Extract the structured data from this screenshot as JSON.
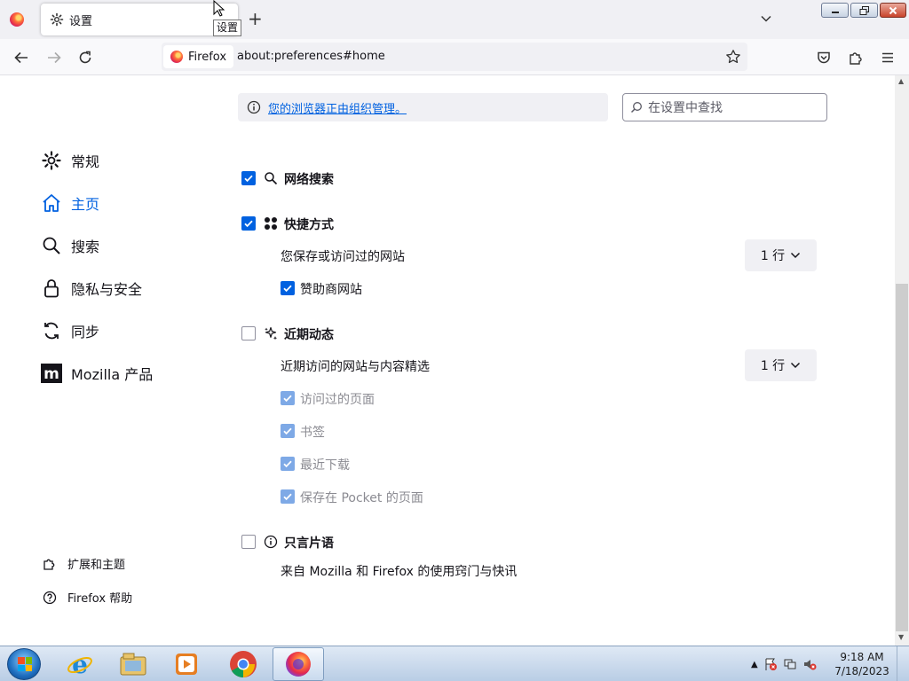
{
  "colors": {
    "accent": "#0061e0",
    "tab_bar": "#f0f0f4",
    "disabled_check": "#7ea9e6"
  },
  "tab": {
    "title": "设置",
    "tooltip": "设置",
    "icon": "gear-icon"
  },
  "urlbar": {
    "identity_label": "Firefox",
    "url": "about:preferences#home"
  },
  "policy_notice": "您的浏览器正由组织管理。",
  "search": {
    "placeholder": "在设置中查找"
  },
  "sidebar": {
    "items": [
      {
        "label": "常规",
        "icon": "gear-icon"
      },
      {
        "label": "主页",
        "icon": "home-icon",
        "active": true
      },
      {
        "label": "搜索",
        "icon": "search-icon"
      },
      {
        "label": "隐私与安全",
        "icon": "lock-icon"
      },
      {
        "label": "同步",
        "icon": "sync-icon"
      },
      {
        "label": "Mozilla 产品",
        "icon": "mozilla-icon"
      }
    ],
    "footer": [
      {
        "label": "扩展和主题",
        "icon": "puzzle-icon"
      },
      {
        "label": "Firefox 帮助",
        "icon": "help-icon"
      }
    ]
  },
  "home_content": {
    "web_search": {
      "label": "网络搜索",
      "checked": true
    },
    "shortcuts": {
      "label": "快捷方式",
      "checked": true,
      "description": "您保存或访问过的网站",
      "rows": "1 行",
      "sponsored": {
        "label": "赞助商网站",
        "checked": true
      }
    },
    "recent_activity": {
      "label": "近期动态",
      "checked": false,
      "description": "近期访问的网站与内容精选",
      "rows": "1 行",
      "options": [
        {
          "label": "访问过的页面",
          "checked": true,
          "disabled": true
        },
        {
          "label": "书签",
          "checked": true,
          "disabled": true
        },
        {
          "label": "最近下载",
          "checked": true,
          "disabled": true
        },
        {
          "label": "保存在 Pocket 的页面",
          "checked": true,
          "disabled": true
        }
      ]
    },
    "snippets": {
      "label": "只言片语",
      "checked": false,
      "description": "来自 Mozilla 和 Firefox 的使用窍门与快讯"
    }
  },
  "taskbar": {
    "apps": [
      "internet-explorer-icon",
      "file-explorer-icon",
      "media-player-icon",
      "chrome-icon",
      "firefox-icon"
    ],
    "clock": {
      "time": "9:18 AM",
      "date": "7/18/2023"
    }
  }
}
